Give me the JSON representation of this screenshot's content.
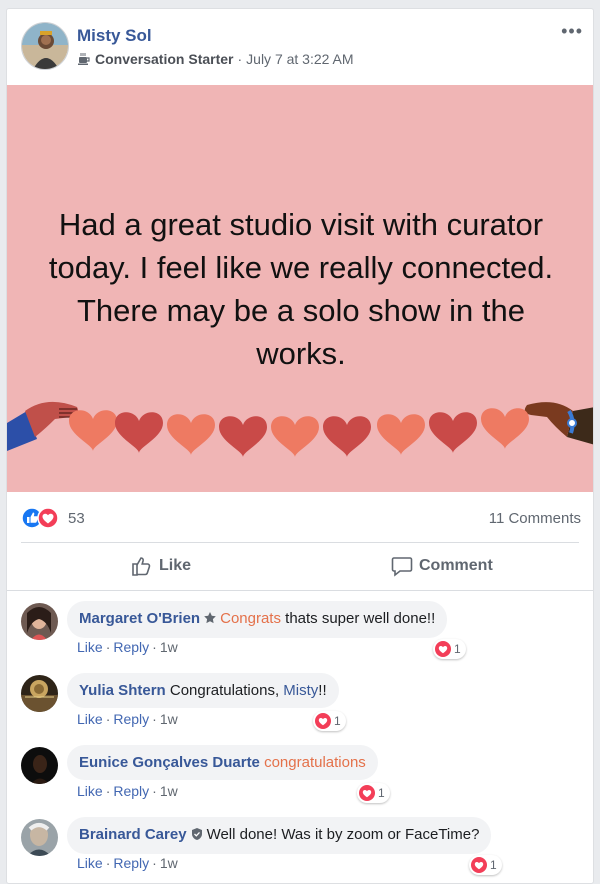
{
  "post": {
    "author": "Misty Sol",
    "badge": "Conversation Starter",
    "timestamp": "July 7 at 3:22 AM",
    "more_label": "•••",
    "text": "Had a great studio visit with curator today. I feel like we really connected. There may be a solo show in the works."
  },
  "stats": {
    "reaction_count": "53",
    "comments_count": "11 Comments"
  },
  "actions": {
    "like": "Like",
    "comment": "Comment"
  },
  "comments": [
    {
      "name": "Margaret O'Brien",
      "badge_icon": "star-badge-icon",
      "text_highlight": "Congrats",
      "text": " thats super well done!!",
      "reactions": "1",
      "like": "Like",
      "reply": "Reply",
      "time": "1w"
    },
    {
      "name": "Yulia Shtern",
      "text": "Congratulations, ",
      "mention": "Misty",
      "text_tail": "!!",
      "reactions": "1",
      "like": "Like",
      "reply": "Reply",
      "time": "1w"
    },
    {
      "name": "Eunice Gonçalves Duarte",
      "text_highlight": "congratulations",
      "reactions": "1",
      "like": "Like",
      "reply": "Reply",
      "time": "1w"
    },
    {
      "name": "Brainard Carey",
      "badge_icon": "shield-badge-icon",
      "text": "Well done! Was it by zoom or FaceTime?",
      "reactions": "1",
      "like": "Like",
      "reply": "Reply",
      "time": "1w"
    }
  ],
  "colors": {
    "link_blue": "#385898",
    "hero_bg": "#f0b5b5",
    "highlight_orange": "#e4714a",
    "heart_red": "#f33e58",
    "like_blue": "#1877f2"
  }
}
